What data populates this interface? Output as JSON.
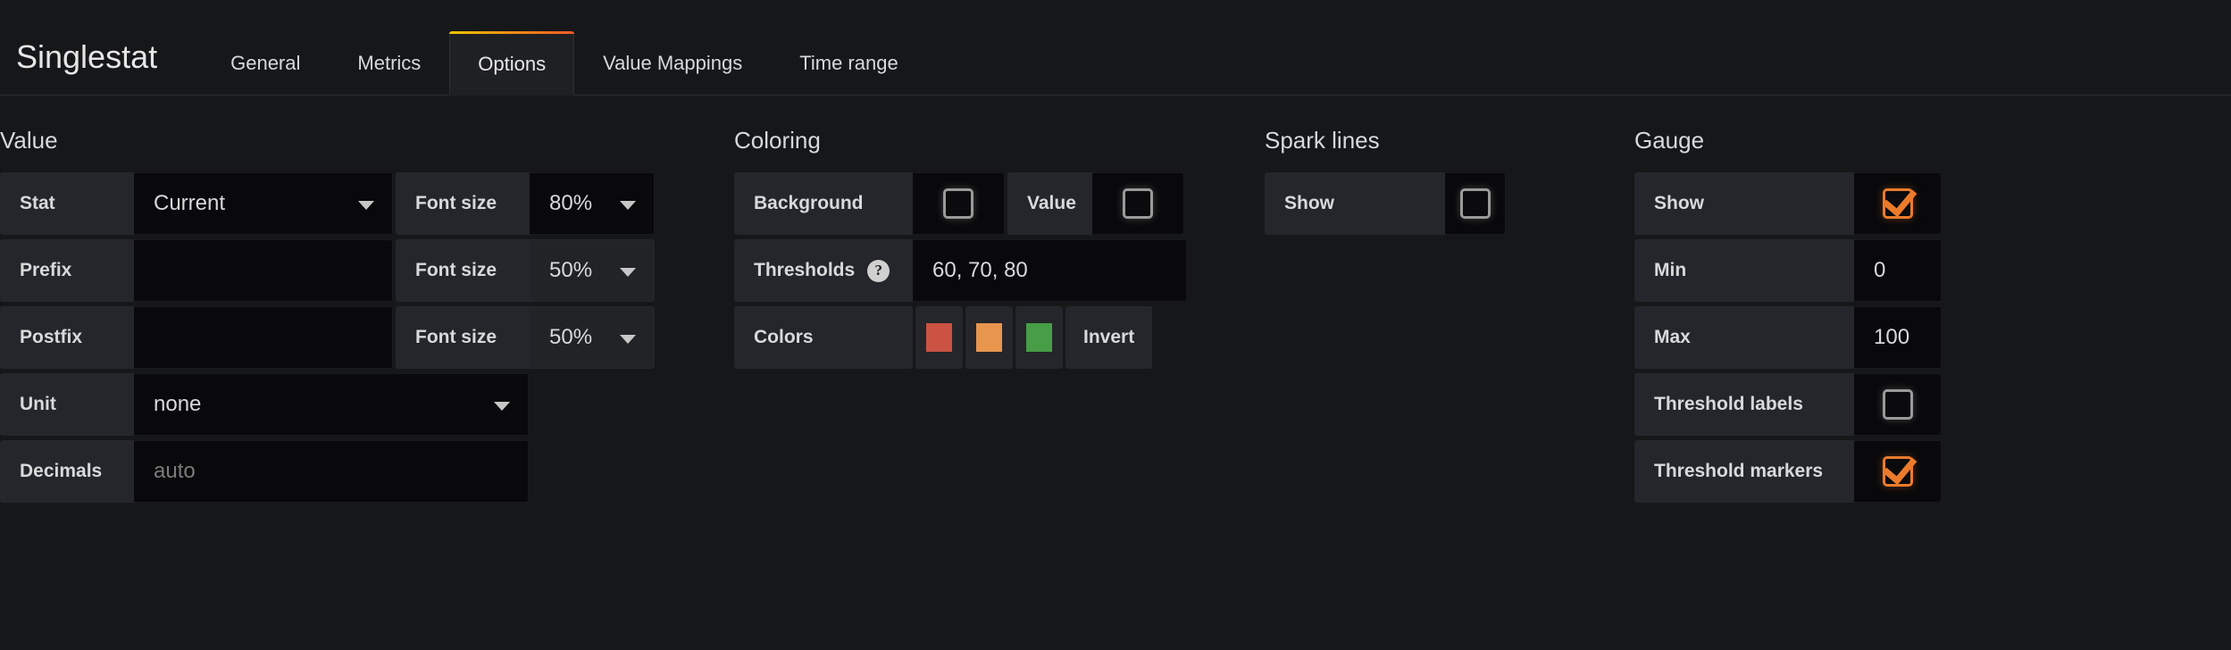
{
  "header": {
    "panel_title": "Singlestat",
    "tabs": [
      {
        "label": "General",
        "active": false
      },
      {
        "label": "Metrics",
        "active": false
      },
      {
        "label": "Options",
        "active": true
      },
      {
        "label": "Value Mappings",
        "active": false
      },
      {
        "label": "Time range",
        "active": false
      }
    ]
  },
  "value_section": {
    "title": "Value",
    "stat": {
      "label": "Stat",
      "value": "Current"
    },
    "stat_font_size": {
      "label": "Font size",
      "value": "80%"
    },
    "prefix": {
      "label": "Prefix",
      "value": ""
    },
    "prefix_font_size": {
      "label": "Font size",
      "value": "50%"
    },
    "postfix": {
      "label": "Postfix",
      "value": ""
    },
    "postfix_font_size": {
      "label": "Font size",
      "value": "50%"
    },
    "unit": {
      "label": "Unit",
      "value": "none"
    },
    "decimals": {
      "label": "Decimals",
      "value": "",
      "placeholder": "auto"
    }
  },
  "coloring_section": {
    "title": "Coloring",
    "background": {
      "label": "Background",
      "checked": false
    },
    "value": {
      "label": "Value",
      "checked": false
    },
    "thresholds": {
      "label": "Thresholds",
      "value": "60, 70, 80",
      "help": "?"
    },
    "colors": {
      "label": "Colors",
      "swatches": [
        "#cc5343",
        "#e8954e",
        "#479e46"
      ],
      "invert_label": "Invert"
    }
  },
  "spark_lines_section": {
    "title": "Spark lines",
    "show": {
      "label": "Show",
      "checked": false
    }
  },
  "gauge_section": {
    "title": "Gauge",
    "show": {
      "label": "Show",
      "checked": true
    },
    "min": {
      "label": "Min",
      "value": "0"
    },
    "max": {
      "label": "Max",
      "value": "100"
    },
    "threshold_labels": {
      "label": "Threshold labels",
      "checked": false
    },
    "threshold_markers": {
      "label": "Threshold markers",
      "checked": true
    }
  },
  "theme": {
    "background": "#161719",
    "accent_start": "#f2c200",
    "accent_end": "#f05a28",
    "checkbox_on": "#eb7b2b"
  }
}
